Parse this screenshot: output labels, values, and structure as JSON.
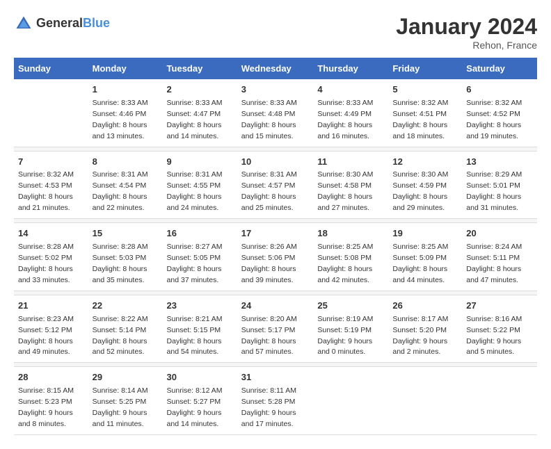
{
  "header": {
    "logo_general": "General",
    "logo_blue": "Blue",
    "title": "January 2024",
    "location": "Rehon, France"
  },
  "columns": [
    "Sunday",
    "Monday",
    "Tuesday",
    "Wednesday",
    "Thursday",
    "Friday",
    "Saturday"
  ],
  "weeks": [
    {
      "days": [
        {
          "num": "",
          "sunrise": "",
          "sunset": "",
          "daylight": ""
        },
        {
          "num": "1",
          "sunrise": "Sunrise: 8:33 AM",
          "sunset": "Sunset: 4:46 PM",
          "daylight": "Daylight: 8 hours and 13 minutes."
        },
        {
          "num": "2",
          "sunrise": "Sunrise: 8:33 AM",
          "sunset": "Sunset: 4:47 PM",
          "daylight": "Daylight: 8 hours and 14 minutes."
        },
        {
          "num": "3",
          "sunrise": "Sunrise: 8:33 AM",
          "sunset": "Sunset: 4:48 PM",
          "daylight": "Daylight: 8 hours and 15 minutes."
        },
        {
          "num": "4",
          "sunrise": "Sunrise: 8:33 AM",
          "sunset": "Sunset: 4:49 PM",
          "daylight": "Daylight: 8 hours and 16 minutes."
        },
        {
          "num": "5",
          "sunrise": "Sunrise: 8:32 AM",
          "sunset": "Sunset: 4:51 PM",
          "daylight": "Daylight: 8 hours and 18 minutes."
        },
        {
          "num": "6",
          "sunrise": "Sunrise: 8:32 AM",
          "sunset": "Sunset: 4:52 PM",
          "daylight": "Daylight: 8 hours and 19 minutes."
        }
      ]
    },
    {
      "days": [
        {
          "num": "7",
          "sunrise": "Sunrise: 8:32 AM",
          "sunset": "Sunset: 4:53 PM",
          "daylight": "Daylight: 8 hours and 21 minutes."
        },
        {
          "num": "8",
          "sunrise": "Sunrise: 8:31 AM",
          "sunset": "Sunset: 4:54 PM",
          "daylight": "Daylight: 8 hours and 22 minutes."
        },
        {
          "num": "9",
          "sunrise": "Sunrise: 8:31 AM",
          "sunset": "Sunset: 4:55 PM",
          "daylight": "Daylight: 8 hours and 24 minutes."
        },
        {
          "num": "10",
          "sunrise": "Sunrise: 8:31 AM",
          "sunset": "Sunset: 4:57 PM",
          "daylight": "Daylight: 8 hours and 25 minutes."
        },
        {
          "num": "11",
          "sunrise": "Sunrise: 8:30 AM",
          "sunset": "Sunset: 4:58 PM",
          "daylight": "Daylight: 8 hours and 27 minutes."
        },
        {
          "num": "12",
          "sunrise": "Sunrise: 8:30 AM",
          "sunset": "Sunset: 4:59 PM",
          "daylight": "Daylight: 8 hours and 29 minutes."
        },
        {
          "num": "13",
          "sunrise": "Sunrise: 8:29 AM",
          "sunset": "Sunset: 5:01 PM",
          "daylight": "Daylight: 8 hours and 31 minutes."
        }
      ]
    },
    {
      "days": [
        {
          "num": "14",
          "sunrise": "Sunrise: 8:28 AM",
          "sunset": "Sunset: 5:02 PM",
          "daylight": "Daylight: 8 hours and 33 minutes."
        },
        {
          "num": "15",
          "sunrise": "Sunrise: 8:28 AM",
          "sunset": "Sunset: 5:03 PM",
          "daylight": "Daylight: 8 hours and 35 minutes."
        },
        {
          "num": "16",
          "sunrise": "Sunrise: 8:27 AM",
          "sunset": "Sunset: 5:05 PM",
          "daylight": "Daylight: 8 hours and 37 minutes."
        },
        {
          "num": "17",
          "sunrise": "Sunrise: 8:26 AM",
          "sunset": "Sunset: 5:06 PM",
          "daylight": "Daylight: 8 hours and 39 minutes."
        },
        {
          "num": "18",
          "sunrise": "Sunrise: 8:25 AM",
          "sunset": "Sunset: 5:08 PM",
          "daylight": "Daylight: 8 hours and 42 minutes."
        },
        {
          "num": "19",
          "sunrise": "Sunrise: 8:25 AM",
          "sunset": "Sunset: 5:09 PM",
          "daylight": "Daylight: 8 hours and 44 minutes."
        },
        {
          "num": "20",
          "sunrise": "Sunrise: 8:24 AM",
          "sunset": "Sunset: 5:11 PM",
          "daylight": "Daylight: 8 hours and 47 minutes."
        }
      ]
    },
    {
      "days": [
        {
          "num": "21",
          "sunrise": "Sunrise: 8:23 AM",
          "sunset": "Sunset: 5:12 PM",
          "daylight": "Daylight: 8 hours and 49 minutes."
        },
        {
          "num": "22",
          "sunrise": "Sunrise: 8:22 AM",
          "sunset": "Sunset: 5:14 PM",
          "daylight": "Daylight: 8 hours and 52 minutes."
        },
        {
          "num": "23",
          "sunrise": "Sunrise: 8:21 AM",
          "sunset": "Sunset: 5:15 PM",
          "daylight": "Daylight: 8 hours and 54 minutes."
        },
        {
          "num": "24",
          "sunrise": "Sunrise: 8:20 AM",
          "sunset": "Sunset: 5:17 PM",
          "daylight": "Daylight: 8 hours and 57 minutes."
        },
        {
          "num": "25",
          "sunrise": "Sunrise: 8:19 AM",
          "sunset": "Sunset: 5:19 PM",
          "daylight": "Daylight: 9 hours and 0 minutes."
        },
        {
          "num": "26",
          "sunrise": "Sunrise: 8:17 AM",
          "sunset": "Sunset: 5:20 PM",
          "daylight": "Daylight: 9 hours and 2 minutes."
        },
        {
          "num": "27",
          "sunrise": "Sunrise: 8:16 AM",
          "sunset": "Sunset: 5:22 PM",
          "daylight": "Daylight: 9 hours and 5 minutes."
        }
      ]
    },
    {
      "days": [
        {
          "num": "28",
          "sunrise": "Sunrise: 8:15 AM",
          "sunset": "Sunset: 5:23 PM",
          "daylight": "Daylight: 9 hours and 8 minutes."
        },
        {
          "num": "29",
          "sunrise": "Sunrise: 8:14 AM",
          "sunset": "Sunset: 5:25 PM",
          "daylight": "Daylight: 9 hours and 11 minutes."
        },
        {
          "num": "30",
          "sunrise": "Sunrise: 8:12 AM",
          "sunset": "Sunset: 5:27 PM",
          "daylight": "Daylight: 9 hours and 14 minutes."
        },
        {
          "num": "31",
          "sunrise": "Sunrise: 8:11 AM",
          "sunset": "Sunset: 5:28 PM",
          "daylight": "Daylight: 9 hours and 17 minutes."
        },
        {
          "num": "",
          "sunrise": "",
          "sunset": "",
          "daylight": ""
        },
        {
          "num": "",
          "sunrise": "",
          "sunset": "",
          "daylight": ""
        },
        {
          "num": "",
          "sunrise": "",
          "sunset": "",
          "daylight": ""
        }
      ]
    }
  ]
}
